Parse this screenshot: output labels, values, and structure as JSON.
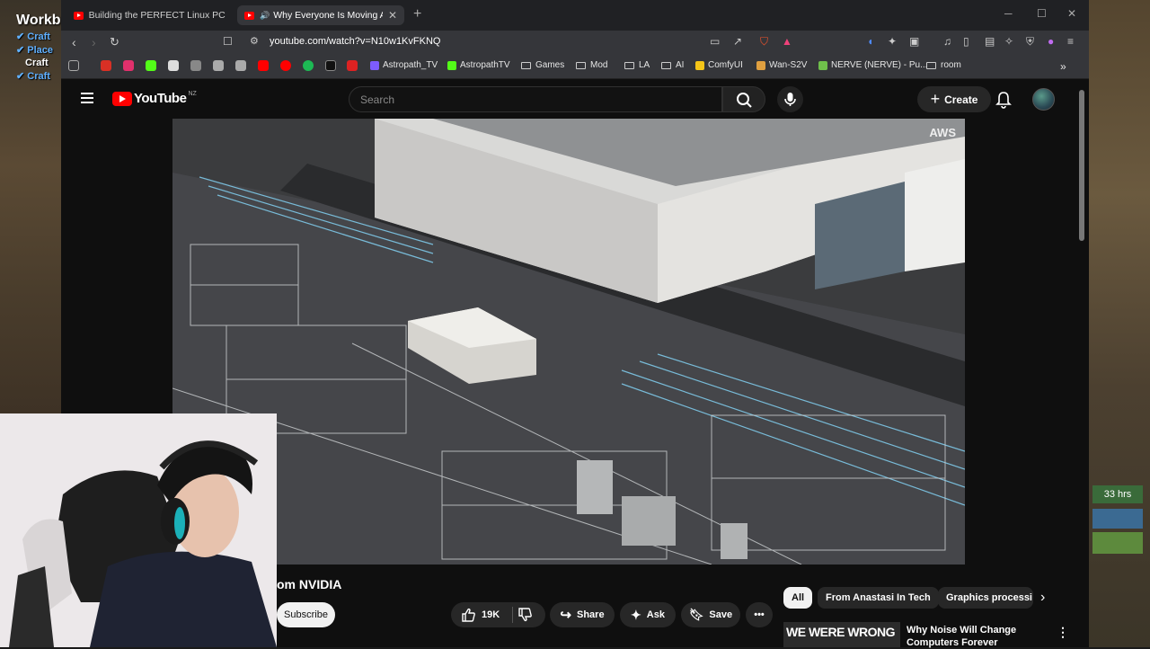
{
  "side_panel": {
    "title": "Workb",
    "items": [
      {
        "label": "Craft",
        "checked": true
      },
      {
        "label": "Place",
        "checked": true
      },
      {
        "label": "Craft",
        "checked": false
      },
      {
        "label": "Craft",
        "checked": true
      }
    ]
  },
  "right_hud": {
    "hours": "33 hrs"
  },
  "tabs": [
    {
      "title": "Building the PERFECT Linux PC with",
      "active": false
    },
    {
      "title": "Why Everyone Is Moving Aw",
      "active": true
    }
  ],
  "address": {
    "url": "youtube.com/watch?v=N10w1KvFKNQ"
  },
  "bookmarks": [
    {
      "label": "Astropath_TV",
      "color": "#7d5cff"
    },
    {
      "label": "AstropathTV",
      "color": "#53fc18"
    },
    {
      "label": "Games",
      "folder": true
    },
    {
      "label": "Mod",
      "folder": true
    },
    {
      "label": "LA",
      "folder": true
    },
    {
      "label": "AI",
      "folder": true
    },
    {
      "label": "ComfyUI",
      "color": "#f5c518"
    },
    {
      "label": "Wan-S2V",
      "color": "#e0a040"
    },
    {
      "label": "NERVE (NERVE) - Pu...",
      "color": "#6fbf4b"
    },
    {
      "label": "room",
      "folder": true
    }
  ],
  "youtube": {
    "logo_text": "YouTube",
    "region": "NZ",
    "search_placeholder": "Search",
    "create_label": "Create",
    "watermark": "AWS"
  },
  "video_info": {
    "title": "om NVIDIA",
    "subscribe": "Subscribe",
    "likes": "19K",
    "share": "Share",
    "ask": "Ask",
    "save": "Save"
  },
  "chips": [
    {
      "label": "All",
      "active": true
    },
    {
      "label": "From Anastasi In Tech",
      "active": false
    },
    {
      "label": "Graphics processi",
      "active": false
    }
  ],
  "recommendation": {
    "thumb_text": "WE WERE WRONG",
    "title": "Why Noise Will Change Computers Forever"
  },
  "colors": {
    "accent": "#ff0000",
    "page_bg": "#0f0f0f"
  }
}
